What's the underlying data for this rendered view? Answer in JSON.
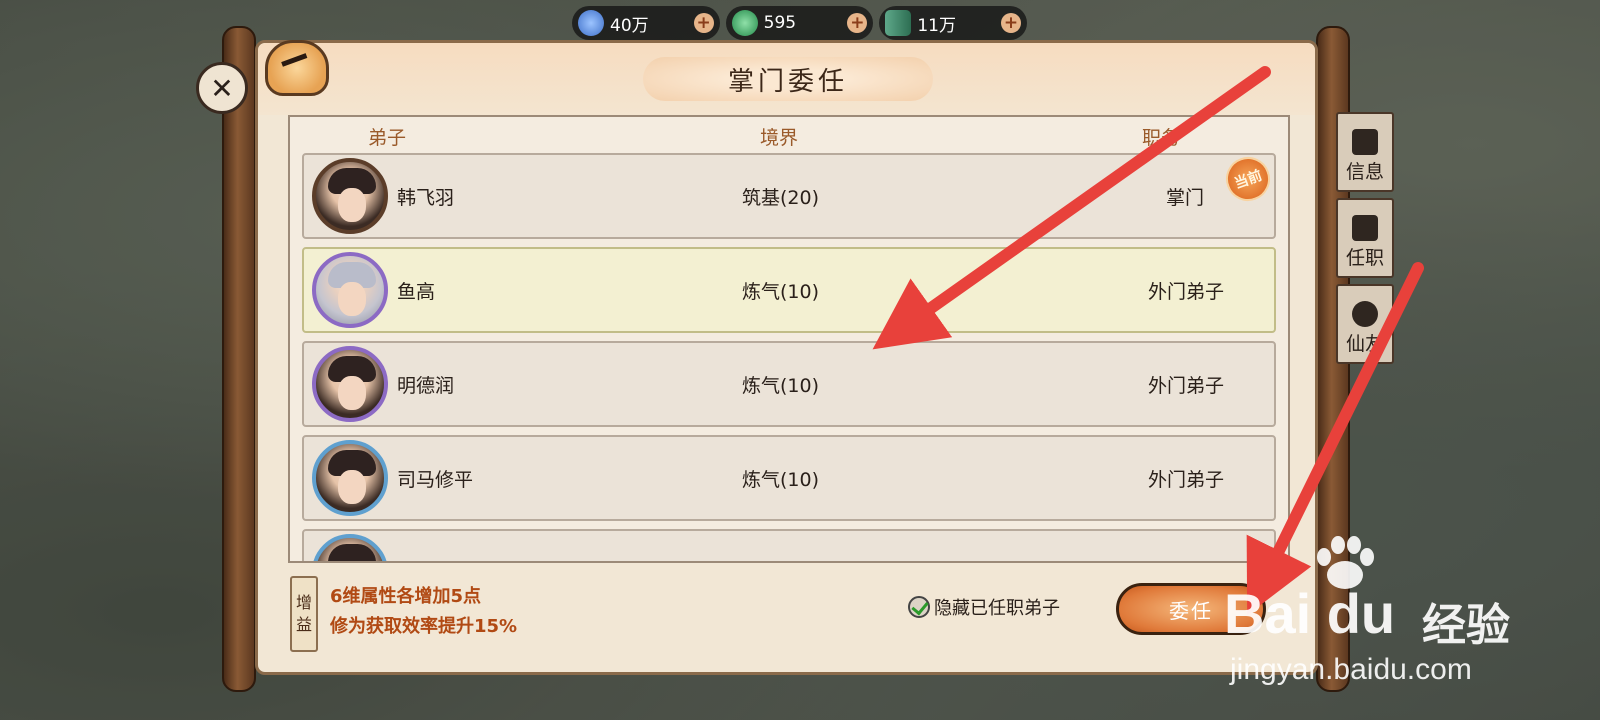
{
  "resources": [
    {
      "name": "spirit-stone",
      "value": "40万",
      "color": "#5b8ad6"
    },
    {
      "name": "jade",
      "value": "595",
      "color": "#2f9a5a"
    },
    {
      "name": "bamboo",
      "value": "11万",
      "color": "#3f8a6a"
    }
  ],
  "dialog": {
    "title": "掌门委任",
    "columns": {
      "disciple": "弟子",
      "realm": "境界",
      "position": "职务"
    }
  },
  "disciples": [
    {
      "name": "韩飞羽",
      "realm": "筑基(20)",
      "position": "掌门",
      "badge": "当前",
      "avatar_style": "dark",
      "selected": false
    },
    {
      "name": "鱼高",
      "realm": "炼气(10)",
      "position": "外门弟子",
      "avatar_style": "silver",
      "selected": true
    },
    {
      "name": "明德润",
      "realm": "炼气(10)",
      "position": "外门弟子",
      "avatar_style": "purple",
      "selected": false
    },
    {
      "name": "司马修平",
      "realm": "炼气(10)",
      "position": "外门弟子",
      "avatar_style": "blue",
      "selected": false
    }
  ],
  "footer": {
    "gain_tag": [
      "增",
      "益"
    ],
    "gain_lines": [
      "6维属性各增加5点",
      "修为获取效率提升15%"
    ],
    "hide_label": "隐藏已任职弟子",
    "hide_checked": true,
    "appoint_label": "委任"
  },
  "side_tabs": [
    {
      "label": "信息",
      "icon": "document-icon"
    },
    {
      "label": "任职",
      "icon": "seal-icon"
    },
    {
      "label": "仙友",
      "icon": "people-icon"
    }
  ],
  "watermark": {
    "brand": "Bai du",
    "cn": "经验",
    "url": "jingyan.baidu.com"
  },
  "colors": {
    "accent": "#e07a3a",
    "arrow": "#e8413b",
    "panel": "#f2e7d5"
  }
}
